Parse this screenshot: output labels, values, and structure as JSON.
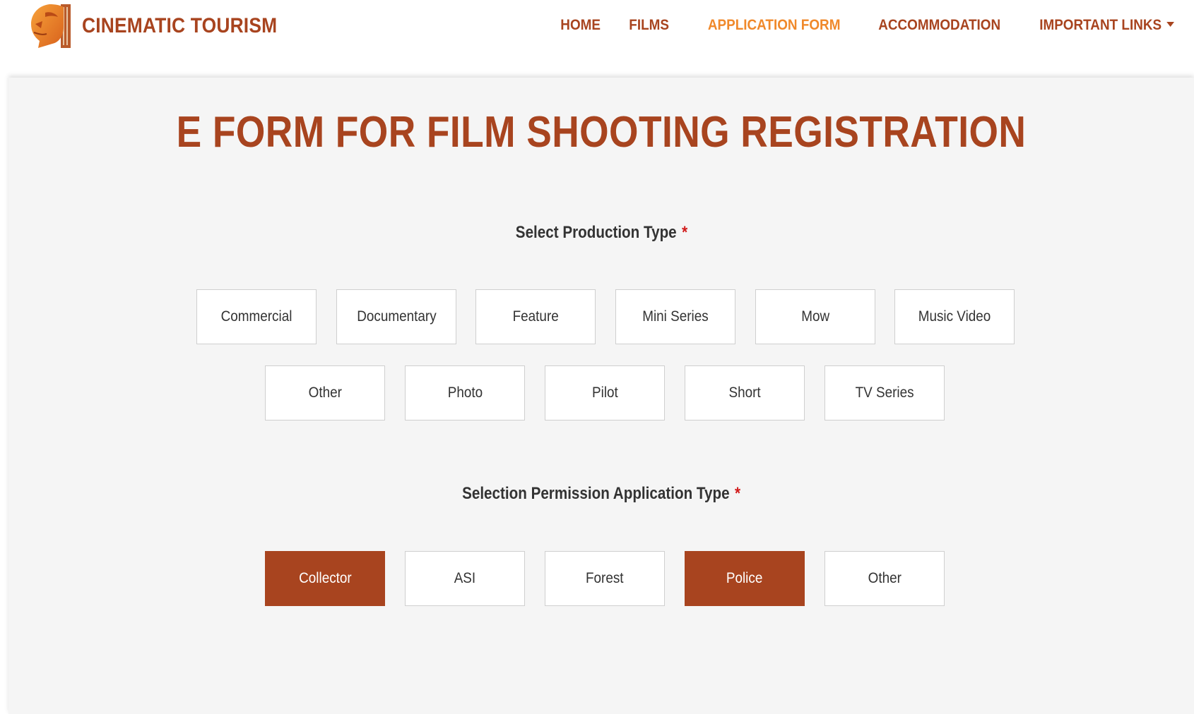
{
  "header": {
    "brand": "CINEMATIC TOURISM",
    "logo_icon": "lion-head-icon",
    "nav": [
      {
        "label": "HOME",
        "active": false
      },
      {
        "label": "FILMS",
        "active": false
      },
      {
        "label": "APPLICATION FORM",
        "active": true
      },
      {
        "label": "ACCOMMODATION",
        "active": false
      },
      {
        "label": "IMPORTANT LINKS",
        "active": false,
        "dropdown": true
      }
    ]
  },
  "main": {
    "title": "E FORM FOR FILM SHOOTING REGISTRATION",
    "production_type": {
      "label": "Select Production Type",
      "required_mark": "*",
      "options": [
        {
          "label": "Commercial",
          "selected": false
        },
        {
          "label": "Documentary",
          "selected": false
        },
        {
          "label": "Feature",
          "selected": false
        },
        {
          "label": "Mini Series",
          "selected": false
        },
        {
          "label": "Mow",
          "selected": false
        },
        {
          "label": "Music Video",
          "selected": false
        },
        {
          "label": "Other",
          "selected": false
        },
        {
          "label": "Photo",
          "selected": false
        },
        {
          "label": "Pilot",
          "selected": false
        },
        {
          "label": "Short",
          "selected": false
        },
        {
          "label": "TV Series",
          "selected": false
        }
      ]
    },
    "permission_type": {
      "label": "Selection Permission Application Type",
      "required_mark": "*",
      "options": [
        {
          "label": "Collector",
          "selected": true
        },
        {
          "label": "ASI",
          "selected": false
        },
        {
          "label": "Forest",
          "selected": false
        },
        {
          "label": "Police",
          "selected": true
        },
        {
          "label": "Other",
          "selected": false
        }
      ]
    }
  },
  "colors": {
    "brand": "#a8441f",
    "nav_active": "#f0892b",
    "background": "#f5f5f5",
    "required": "#d11a1a"
  }
}
